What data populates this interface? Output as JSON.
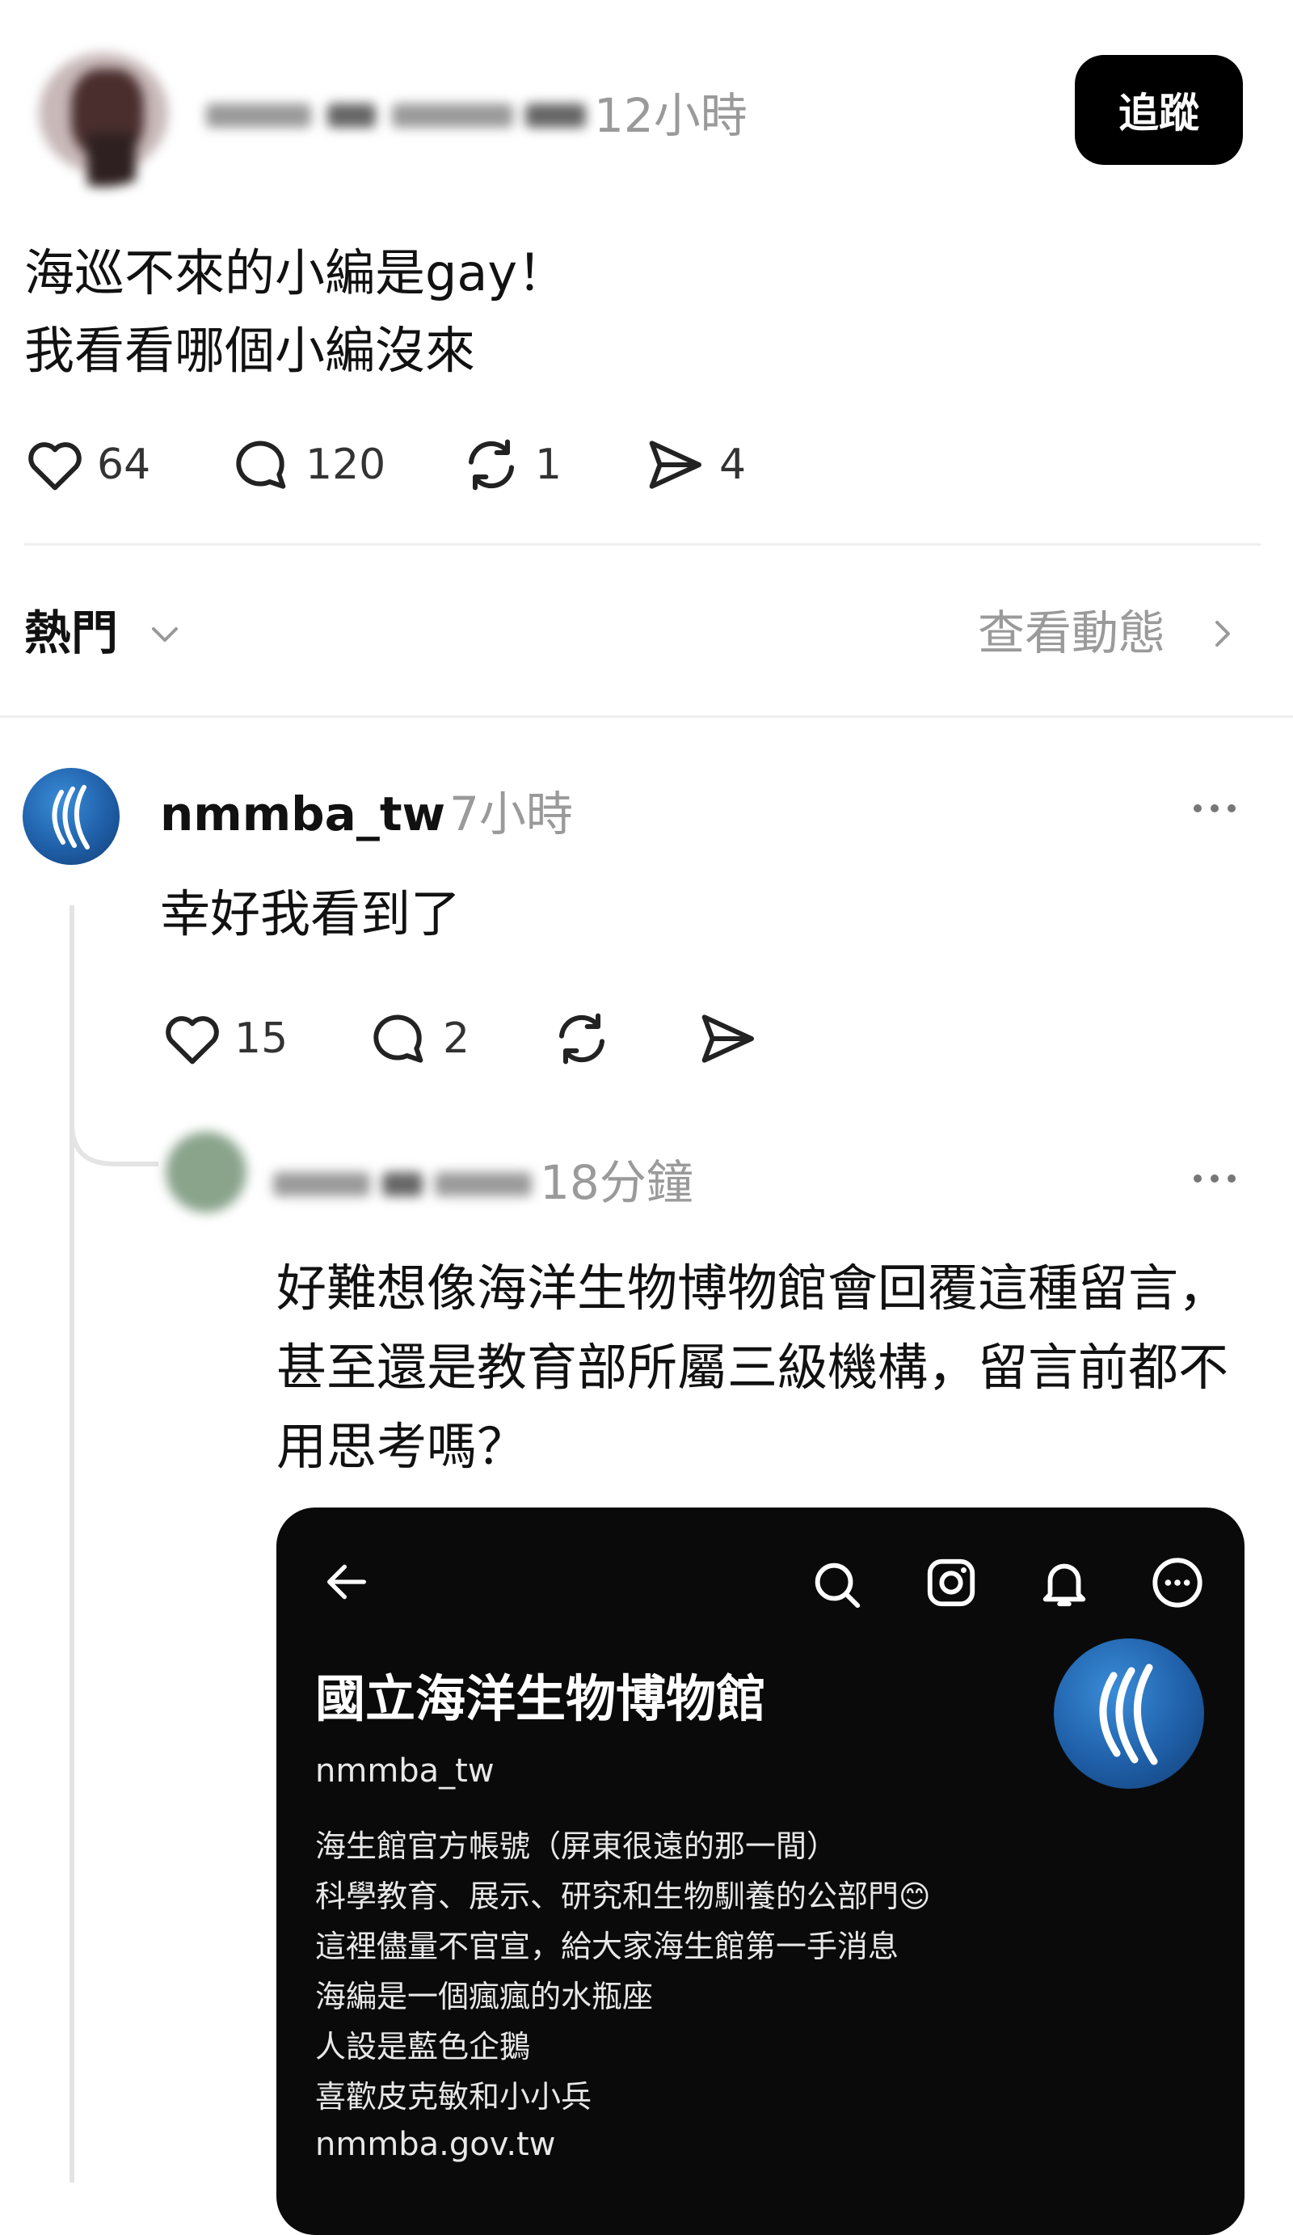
{
  "post": {
    "time": "12小時",
    "follow_label": "追蹤",
    "text": "海巡不來的小編是gay！\n我看看哪個小編沒來",
    "stats": {
      "likes": "64",
      "comments": "120",
      "reposts": "1",
      "shares": "4"
    }
  },
  "sort": {
    "label": "熱門",
    "activity": "查看動態"
  },
  "reply": {
    "username": "nmmba_tw",
    "time": "7小時",
    "text": "幸好我看到了",
    "stats": {
      "likes": "15",
      "comments": "2"
    }
  },
  "nested": {
    "time": "18分鐘",
    "text": "好難想像海洋生物博物館會回覆這種留言，甚至還是教育部所屬三級機構，留言前都不用思考嗎？"
  },
  "card": {
    "title": "國立海洋生物博物館",
    "handle": "nmmba_tw",
    "bio": [
      "海生館官方帳號（屏東很遠的那一間）",
      "科學教育、展示、研究和生物馴養的公部門😊",
      "這裡儘量不官宣，給大家海生館第一手消息",
      "海編是一個瘋瘋的水瓶座",
      "人設是藍色企鵝",
      "喜歡皮克敏和小小兵"
    ],
    "link": "nmmba.gov.tw"
  },
  "icons": {
    "like": "heart-icon",
    "comment": "comment-bubble-icon",
    "repost": "repost-icon",
    "share": "send-icon",
    "more": "more-dots-icon",
    "chevron": "chevron-down-icon"
  }
}
